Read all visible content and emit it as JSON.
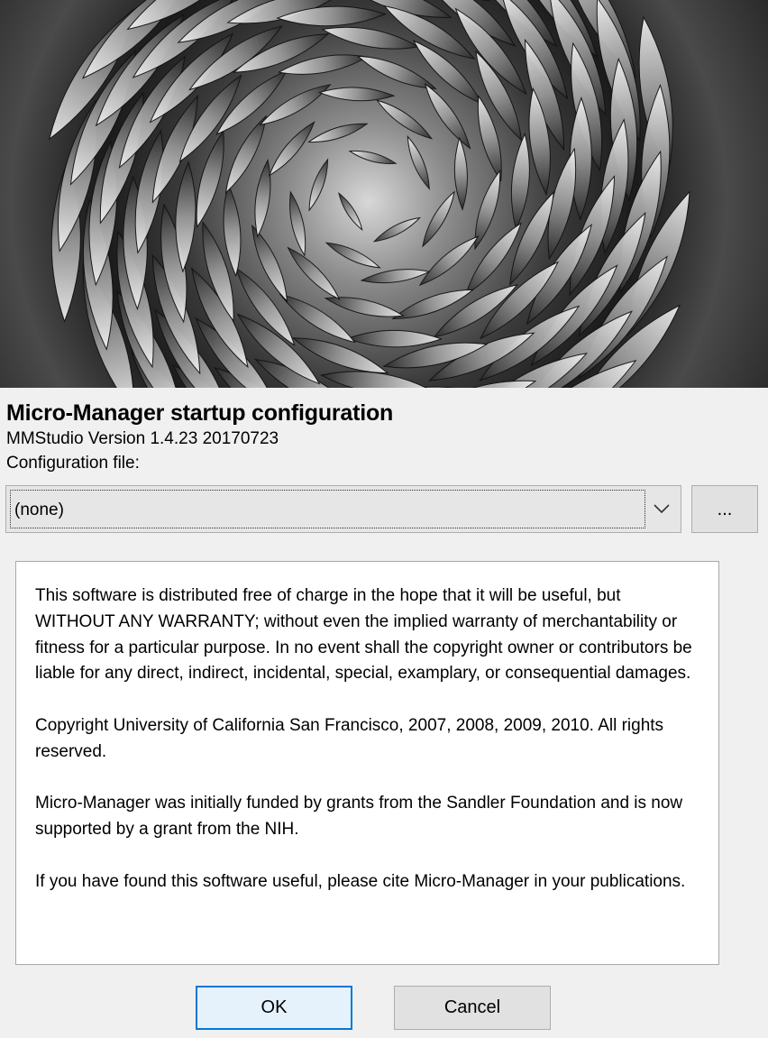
{
  "splash": {
    "icon": "succulent-spiral-photo"
  },
  "header": {
    "title": "Micro-Manager startup configuration",
    "version": "MMStudio Version 1.4.23 20170723",
    "config_label": "Configuration file:"
  },
  "config": {
    "selected": "(none)",
    "dropdown_icon": "chevron-down-icon",
    "browse_label": "..."
  },
  "license": {
    "paragraphs": [
      "This software is distributed free of charge in the hope that it will be useful, but WITHOUT ANY WARRANTY; without even the implied warranty of merchantability or fitness for a particular purpose. In no event shall the copyright owner or contributors be liable for any direct, indirect, incidental, special, examplary, or consequential damages.",
      "Copyright University of California San Francisco, 2007, 2008, 2009, 2010. All rights reserved.",
      "Micro-Manager was initially funded by grants from the Sandler Foundation and is now supported by a grant from the NIH.",
      "If you have found this software useful, please cite Micro-Manager in your publications."
    ]
  },
  "buttons": {
    "ok": "OK",
    "cancel": "Cancel"
  },
  "colors": {
    "ok_border": "#0078d7",
    "ok_fill": "#e5f1fb",
    "window_bg": "#f0f0f0"
  }
}
